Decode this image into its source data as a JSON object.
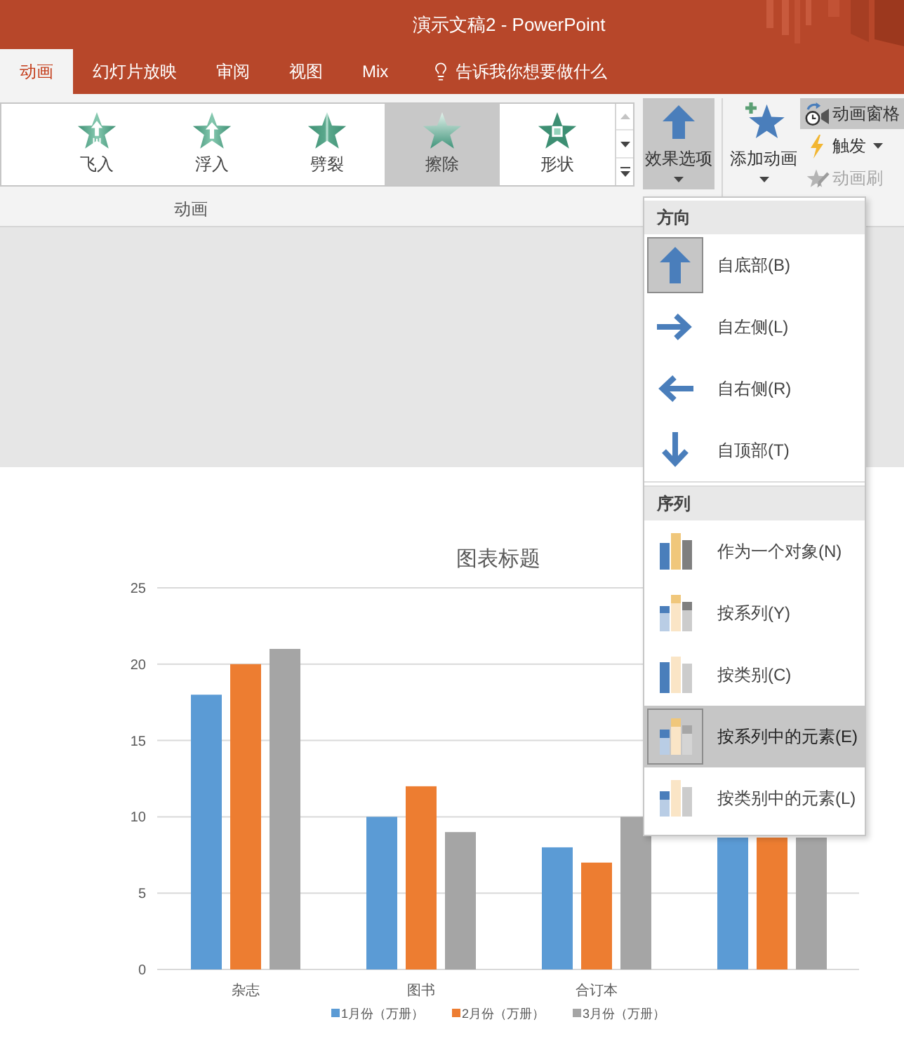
{
  "window": {
    "title": "演示文稿2 - PowerPoint"
  },
  "tabs": [
    {
      "label": "动画",
      "selected": true
    },
    {
      "label": "幻灯片放映",
      "selected": false
    },
    {
      "label": "审阅",
      "selected": false
    },
    {
      "label": "视图",
      "selected": false
    },
    {
      "label": "Mix",
      "selected": false
    }
  ],
  "tell_me": {
    "placeholder": "告诉我你想要做什么"
  },
  "ribbon": {
    "gallery": {
      "items": [
        {
          "kind": "fly_in",
          "label": "飞入",
          "selected": false
        },
        {
          "kind": "float_in",
          "label": "浮入",
          "selected": false
        },
        {
          "kind": "split",
          "label": "劈裂",
          "selected": false
        },
        {
          "kind": "wipe",
          "label": "擦除",
          "selected": true
        },
        {
          "kind": "shape",
          "label": "形状",
          "selected": false
        }
      ],
      "group_label": "动画"
    },
    "effect_options": {
      "label": "效果选项",
      "expanded": true
    },
    "add_animation": {
      "label": "添加动画"
    },
    "side_buttons": [
      {
        "kind": "pane",
        "label": "动画窗格",
        "on": true,
        "disabled": false,
        "caret": false
      },
      {
        "kind": "trigger",
        "label": "触发",
        "on": false,
        "disabled": false,
        "caret": true
      },
      {
        "kind": "painter",
        "label": "动画刷",
        "on": false,
        "disabled": true,
        "caret": false
      }
    ]
  },
  "effect_menu": {
    "sections": [
      {
        "heading": "方向",
        "items": [
          {
            "kind": "up",
            "label": "自底部(B)",
            "selected": true,
            "hovered": false
          },
          {
            "kind": "right",
            "label": "自左侧(L)",
            "selected": false,
            "hovered": false
          },
          {
            "kind": "left",
            "label": "自右侧(R)",
            "selected": false,
            "hovered": false
          },
          {
            "kind": "down",
            "label": "自顶部(T)",
            "selected": false,
            "hovered": false
          }
        ]
      },
      {
        "heading": "序列",
        "items": [
          {
            "kind": "one_object",
            "label": "作为一个对象(N)",
            "selected": false,
            "hovered": false
          },
          {
            "kind": "by_series",
            "label": "按系列(Y)",
            "selected": false,
            "hovered": false
          },
          {
            "kind": "by_category",
            "label": "按类别(C)",
            "selected": false,
            "hovered": false
          },
          {
            "kind": "by_series_element",
            "label": "按系列中的元素(E)",
            "selected": true,
            "hovered": true
          },
          {
            "kind": "by_category_element",
            "label": "按类别中的元素(L)",
            "selected": false,
            "hovered": false
          }
        ]
      }
    ]
  },
  "slide": {
    "chart_data": {
      "type": "bar",
      "title": "图表标题",
      "categories": [
        "杂志",
        "图书",
        "合订本",
        null
      ],
      "series": [
        {
          "name": "1月份（万册）",
          "color": "#5b9bd5",
          "values": [
            18,
            10,
            8,
            null
          ]
        },
        {
          "name": "2月份（万册）",
          "color": "#ed7d31",
          "values": [
            20,
            12,
            7,
            null
          ]
        },
        {
          "name": "3月份（万册）",
          "color": "#a5a5a5",
          "values": [
            21,
            9,
            10,
            null
          ]
        }
      ],
      "ylim": [
        0,
        25
      ],
      "yticks": [
        0,
        5,
        10,
        15,
        20,
        25
      ],
      "grid": true,
      "legend": "bottom"
    },
    "covered_bars": [
      {
        "color": "#5b9bd5"
      },
      {
        "color": "#ed7d31"
      },
      {
        "color": "#a5a5a5"
      }
    ]
  }
}
